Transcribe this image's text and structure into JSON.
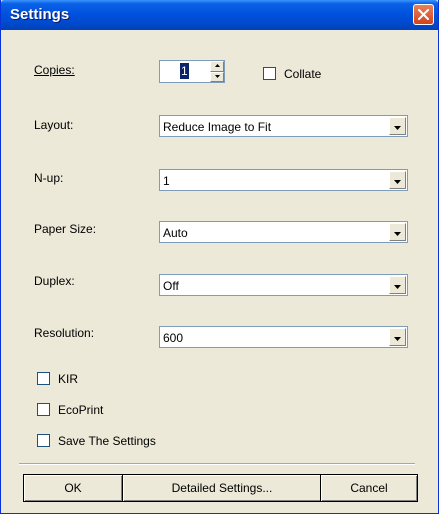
{
  "window": {
    "title": "Settings"
  },
  "copies": {
    "label": "Copies:",
    "value": "1"
  },
  "collate": {
    "label": "Collate",
    "checked": false
  },
  "layout": {
    "label": "Layout:",
    "value": "Reduce Image to Fit"
  },
  "nup": {
    "label": "N-up:",
    "value": "1"
  },
  "paper_size": {
    "label": "Paper Size:",
    "value": "Auto"
  },
  "duplex": {
    "label": "Duplex:",
    "value": "Off"
  },
  "resolution": {
    "label": "Resolution:",
    "value": "600"
  },
  "kir": {
    "label": "KIR",
    "checked": false
  },
  "ecoprint": {
    "label": "EcoPrint",
    "checked": false
  },
  "save_settings": {
    "label": "Save The Settings",
    "checked": false
  },
  "buttons": {
    "ok": "OK",
    "detailed": "Detailed Settings...",
    "cancel": "Cancel"
  },
  "icons": {
    "close": "close-icon",
    "spin_up": "spin-up-icon",
    "spin_down": "spin-down-icon",
    "dropdown": "chevron-down-icon"
  },
  "colors": {
    "titlebar": "#0052de",
    "dialog_bg": "#ece9d8",
    "close_button": "#d4431c",
    "selection": "#0a246a"
  }
}
